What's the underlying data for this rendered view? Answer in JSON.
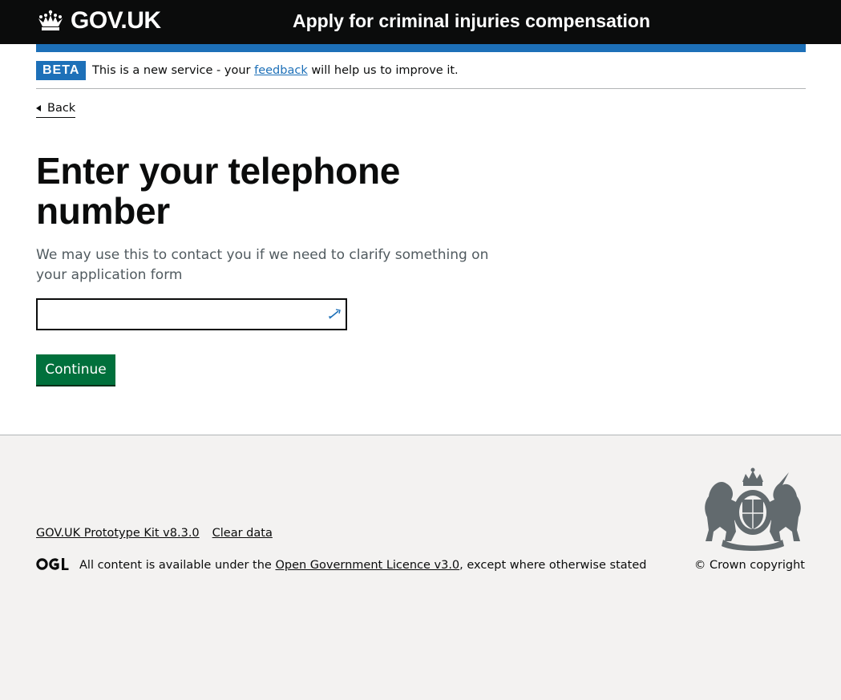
{
  "header": {
    "logo_text": "GOV.UK",
    "service_name": "Apply for criminal injuries compensation"
  },
  "phase_banner": {
    "tag": "BETA",
    "text_before": "This is a new service - your ",
    "link_text": "feedback",
    "text_after": " will help us to improve it."
  },
  "back_link": "Back",
  "main": {
    "heading": "Enter your telephone number",
    "hint": "We may use this to contact you if we need to clarify something on your application form",
    "input_value": "",
    "input_placeholder": "",
    "continue_label": "Continue"
  },
  "footer": {
    "links": [
      "GOV.UK Prototype Kit v8.3.0",
      "Clear data"
    ],
    "licence_before": "All content is available under the ",
    "licence_link": "Open Government Licence v3.0",
    "licence_after": ", except where otherwise stated",
    "copyright": "© Crown copyright"
  },
  "colors": {
    "header_bg": "#0b0c0c",
    "brand_blue": "#1d70b8",
    "button_green": "#00703c",
    "footer_bg": "#f3f2f1",
    "hint_grey": "#505a5f"
  },
  "icons": {
    "logo": "crown-icon",
    "back": "back-arrow-icon",
    "autofill": "autofill-key-icon",
    "licence": "ogl-logo-icon",
    "crest": "royal-coat-of-arms-icon"
  }
}
